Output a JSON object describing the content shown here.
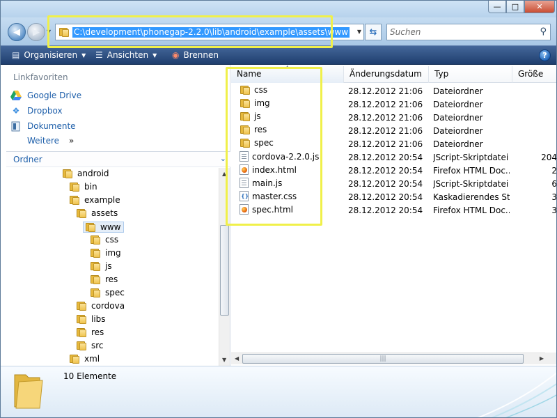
{
  "window": {
    "minimize_glyph": "—",
    "maximize_glyph": "□",
    "close_glyph": "✕"
  },
  "address": {
    "path": "C:\\development\\phonegap-2.2.0\\lib\\android\\example\\assets\\www",
    "search_placeholder": "Suchen"
  },
  "commandbar": {
    "organize": "Organisieren",
    "views": "Ansichten",
    "burn": "Brennen",
    "help": "?"
  },
  "nav": {
    "favorites_heading": "Linkfavoriten",
    "favorites": [
      {
        "label": "Google Drive",
        "icon": "google-drive-icon"
      },
      {
        "label": "Dropbox",
        "icon": "dropbox-icon"
      },
      {
        "label": "Dokumente",
        "icon": "documents-icon"
      }
    ],
    "more_label": "Weitere",
    "more_glyph": "»",
    "folders_heading": "Ordner",
    "tree": [
      {
        "label": "android",
        "depth": 0
      },
      {
        "label": "bin",
        "depth": 1
      },
      {
        "label": "example",
        "depth": 1
      },
      {
        "label": "assets",
        "depth": 2
      },
      {
        "label": "www",
        "depth": 3,
        "selected": true
      },
      {
        "label": "css",
        "depth": 4
      },
      {
        "label": "img",
        "depth": 4
      },
      {
        "label": "js",
        "depth": 4
      },
      {
        "label": "res",
        "depth": 4
      },
      {
        "label": "spec",
        "depth": 4
      },
      {
        "label": "cordova",
        "depth": 2
      },
      {
        "label": "libs",
        "depth": 2
      },
      {
        "label": "res",
        "depth": 2
      },
      {
        "label": "src",
        "depth": 2
      },
      {
        "label": "xml",
        "depth": 1
      }
    ]
  },
  "list": {
    "columns": {
      "name": "Name",
      "date": "Änderungsdatum",
      "type": "Typ",
      "size": "Größe"
    },
    "rows": [
      {
        "name": "css",
        "date": "28.12.2012 21:06",
        "type": "Dateiordner",
        "size": "",
        "kind": "folder"
      },
      {
        "name": "img",
        "date": "28.12.2012 21:06",
        "type": "Dateiordner",
        "size": "",
        "kind": "folder"
      },
      {
        "name": "js",
        "date": "28.12.2012 21:06",
        "type": "Dateiordner",
        "size": "",
        "kind": "folder"
      },
      {
        "name": "res",
        "date": "28.12.2012 21:06",
        "type": "Dateiordner",
        "size": "",
        "kind": "folder"
      },
      {
        "name": "spec",
        "date": "28.12.2012 21:06",
        "type": "Dateiordner",
        "size": "",
        "kind": "folder"
      },
      {
        "name": "cordova-2.2.0.js",
        "date": "28.12.2012 20:54",
        "type": "JScript-Skriptdatei",
        "size": "204",
        "kind": "js"
      },
      {
        "name": "index.html",
        "date": "28.12.2012 20:54",
        "type": "Firefox HTML Doc...",
        "size": "2",
        "kind": "html"
      },
      {
        "name": "main.js",
        "date": "28.12.2012 20:54",
        "type": "JScript-Skriptdatei",
        "size": "6",
        "kind": "js"
      },
      {
        "name": "master.css",
        "date": "28.12.2012 20:54",
        "type": "Kaskadierendes St...",
        "size": "3",
        "kind": "css"
      },
      {
        "name": "spec.html",
        "date": "28.12.2012 20:54",
        "type": "Firefox HTML Doc...",
        "size": "3",
        "kind": "html"
      }
    ]
  },
  "details": {
    "count": "10 Elemente"
  },
  "colors": {
    "highlight": "#f0f04a",
    "selection": "#3399ff",
    "link": "#1e5faa"
  }
}
